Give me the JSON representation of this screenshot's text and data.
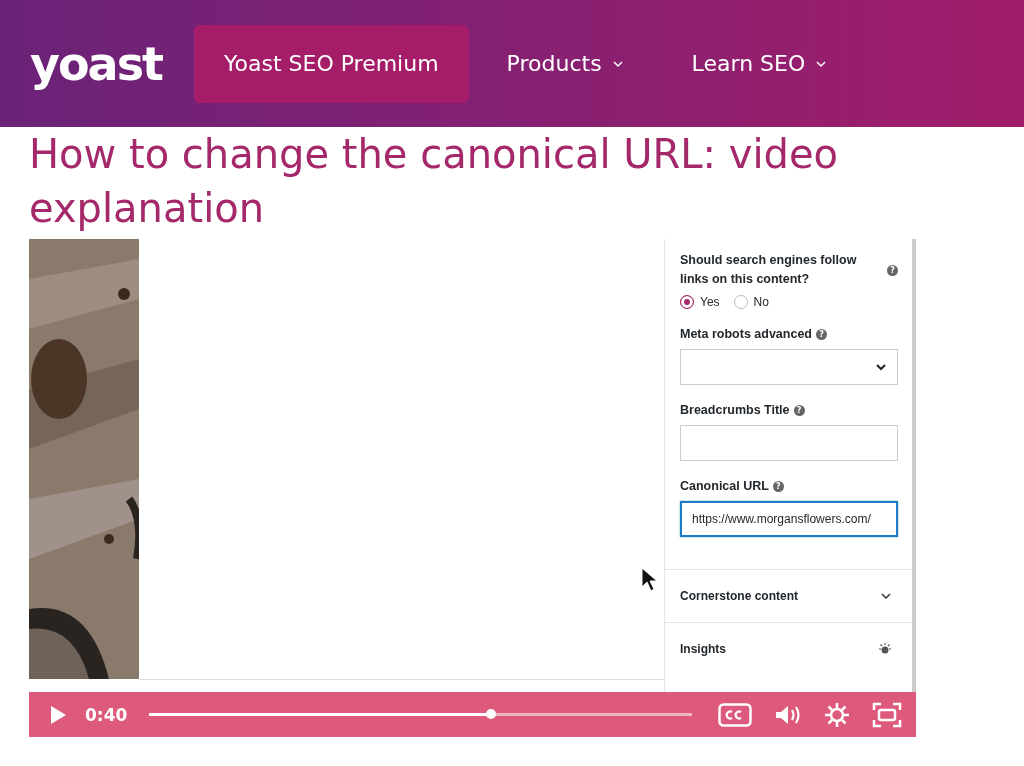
{
  "header": {
    "logo": "yoast",
    "nav": [
      {
        "label": "Yoast SEO Premium",
        "selected": true,
        "dropdown": false
      },
      {
        "label": "Products",
        "selected": false,
        "dropdown": true
      },
      {
        "label": "Learn SEO",
        "selected": false,
        "dropdown": true
      }
    ]
  },
  "title": "How to change the canonical URL: video explanation",
  "video": {
    "panel": {
      "follow": {
        "question": "Should search engines follow links on this content?",
        "help": "?",
        "options": [
          {
            "label": "Yes",
            "selected": true
          },
          {
            "label": "No",
            "selected": false
          }
        ]
      },
      "fields": [
        {
          "label": "Meta robots advanced",
          "help": "?",
          "kind": "select",
          "focused": false
        },
        {
          "label": "Breadcrumbs Title",
          "help": "?",
          "kind": "text",
          "focused": false
        },
        {
          "label": "Canonical URL",
          "help": "?",
          "kind": "text",
          "value": "https://www.morgansflowers.com/",
          "focused": true
        }
      ],
      "sections": [
        {
          "label": "Cornerstone content",
          "kind": "chevron"
        },
        {
          "label": "Insights",
          "kind": "bulb"
        }
      ]
    },
    "player": {
      "time": "0:40",
      "level": 0.63
    }
  }
}
